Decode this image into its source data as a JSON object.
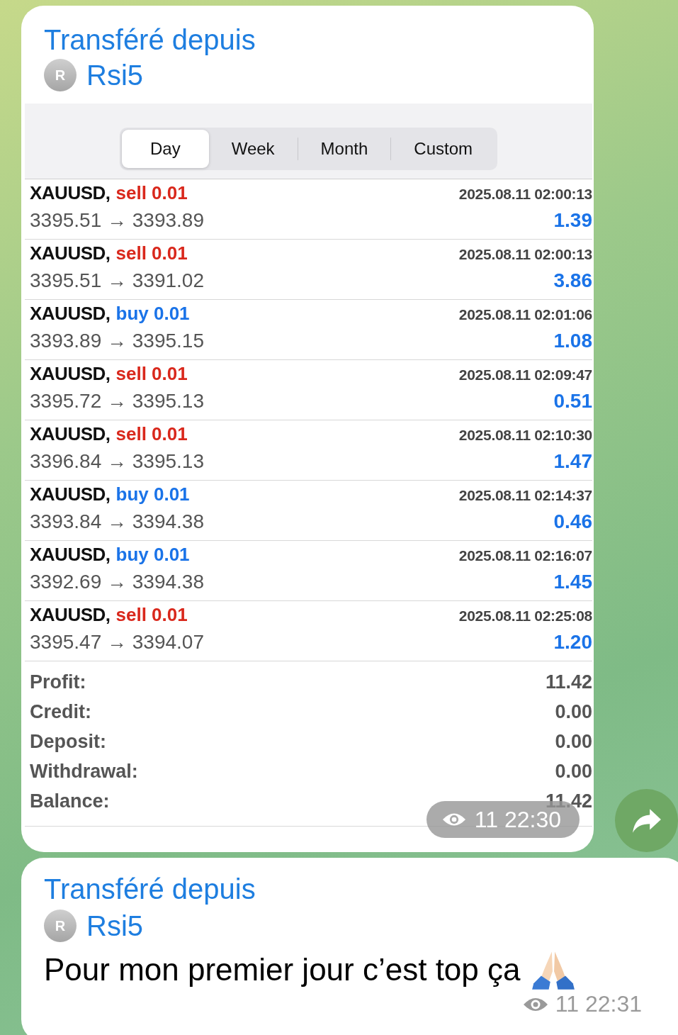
{
  "messages": [
    {
      "kind": "screenshot",
      "forwarded_label": "Transféré depuis",
      "sender": {
        "initial": "R",
        "name": "Rsi5"
      },
      "screenshot": {
        "tabs": [
          {
            "label": "Day",
            "selected": true
          },
          {
            "label": "Week",
            "selected": false
          },
          {
            "label": "Month",
            "selected": false
          },
          {
            "label": "Custom",
            "selected": false
          }
        ],
        "trades": [
          {
            "symbol": "XAUUSD,",
            "side": "sell",
            "kind": "sell",
            "volume": "0.01",
            "open": "3395.51",
            "arrow": "→",
            "close": "3393.89",
            "time": "2025.08.11 02:00:13",
            "profit": "1.39"
          },
          {
            "symbol": "XAUUSD,",
            "side": "sell",
            "kind": "sell",
            "volume": "0.01",
            "open": "3395.51",
            "arrow": "→",
            "close": "3391.02",
            "time": "2025.08.11 02:00:13",
            "profit": "3.86"
          },
          {
            "symbol": "XAUUSD,",
            "side": "buy",
            "kind": "buy",
            "volume": "0.01",
            "open": "3393.89",
            "arrow": "→",
            "close": "3395.15",
            "time": "2025.08.11 02:01:06",
            "profit": "1.08"
          },
          {
            "symbol": "XAUUSD,",
            "side": "sell",
            "kind": "sell",
            "volume": "0.01",
            "open": "3395.72",
            "arrow": "→",
            "close": "3395.13",
            "time": "2025.08.11 02:09:47",
            "profit": "0.51"
          },
          {
            "symbol": "XAUUSD,",
            "side": "sell",
            "kind": "sell",
            "volume": "0.01",
            "open": "3396.84",
            "arrow": "→",
            "close": "3395.13",
            "time": "2025.08.11 02:10:30",
            "profit": "1.47"
          },
          {
            "symbol": "XAUUSD,",
            "side": "buy",
            "kind": "buy",
            "volume": "0.01",
            "open": "3393.84",
            "arrow": "→",
            "close": "3394.38",
            "time": "2025.08.11 02:14:37",
            "profit": "0.46"
          },
          {
            "symbol": "XAUUSD,",
            "side": "buy",
            "kind": "buy",
            "volume": "0.01",
            "open": "3392.69",
            "arrow": "→",
            "close": "3394.38",
            "time": "2025.08.11 02:16:07",
            "profit": "1.45"
          },
          {
            "symbol": "XAUUSD,",
            "side": "sell",
            "kind": "sell",
            "volume": "0.01",
            "open": "3395.47",
            "arrow": "→",
            "close": "3394.07",
            "time": "2025.08.11 02:25:08",
            "profit": "1.20"
          }
        ],
        "summary": [
          {
            "label": "Profit:",
            "value": "11.42"
          },
          {
            "label": "Credit:",
            "value": "0.00"
          },
          {
            "label": "Deposit:",
            "value": "0.00"
          },
          {
            "label": "Withdrawal:",
            "value": "0.00"
          },
          {
            "label": "Balance:",
            "value": "11.42"
          }
        ]
      },
      "views": "11",
      "time": "22:30"
    },
    {
      "kind": "text",
      "forwarded_label": "Transféré depuis",
      "sender": {
        "initial": "R",
        "name": "Rsi5"
      },
      "text": "Pour mon premier jour c’est top ça",
      "views": "11",
      "time": "22:31"
    }
  ]
}
